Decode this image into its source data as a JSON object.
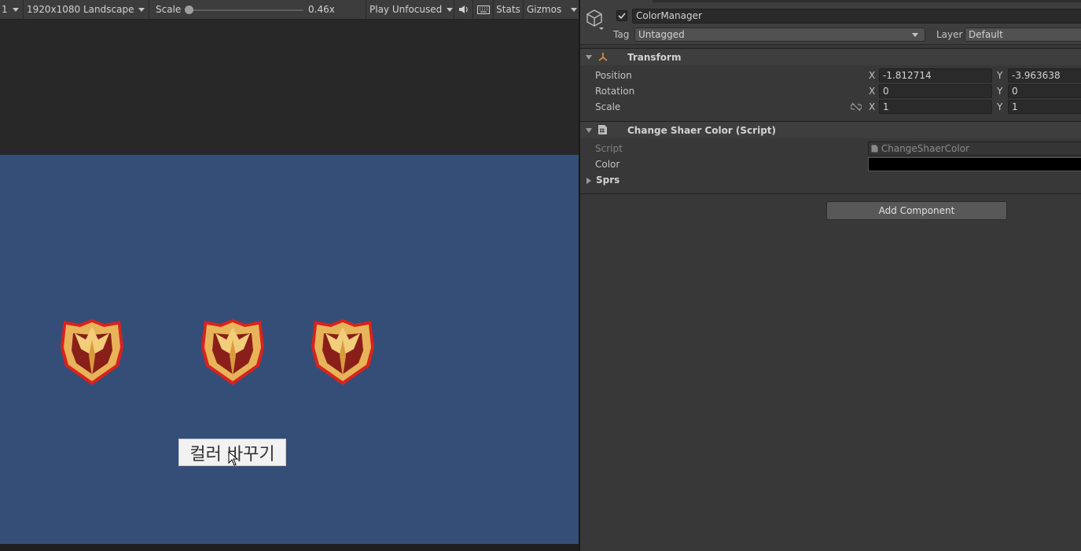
{
  "game_view": {
    "display_number": "1",
    "resolution": "1920x1080 Landscape",
    "scale_label": "Scale",
    "scale_value": "0.46x",
    "play_mode": "Play Unfocused",
    "stats_label": "Stats",
    "gizmos_label": "Gizmos",
    "viewport_color": "#344e78",
    "change_color_button": "컬러 바꾸기",
    "shield_count": 3
  },
  "inspector": {
    "object_name": "ColorManager",
    "active": true,
    "tag_label": "Tag",
    "tag_value": "Untagged",
    "layer_label": "Layer",
    "layer_value": "Default",
    "transform": {
      "title": "Transform",
      "position_label": "Position",
      "rotation_label": "Rotation",
      "scale_label": "Scale",
      "position": {
        "x": "-1.812714",
        "y": "-3.963638"
      },
      "rotation": {
        "x": "0",
        "y": "0"
      },
      "scale": {
        "x": "1",
        "y": "1"
      }
    },
    "script_component": {
      "title": "Change Shaer Color (Script)",
      "script_label": "Script",
      "script_value": "ChangeShaerColor",
      "color_label": "Color",
      "color_value": "#000000",
      "sprs_label": "Sprs"
    },
    "add_component_label": "Add Component"
  },
  "axis": {
    "x": "X",
    "y": "Y"
  }
}
